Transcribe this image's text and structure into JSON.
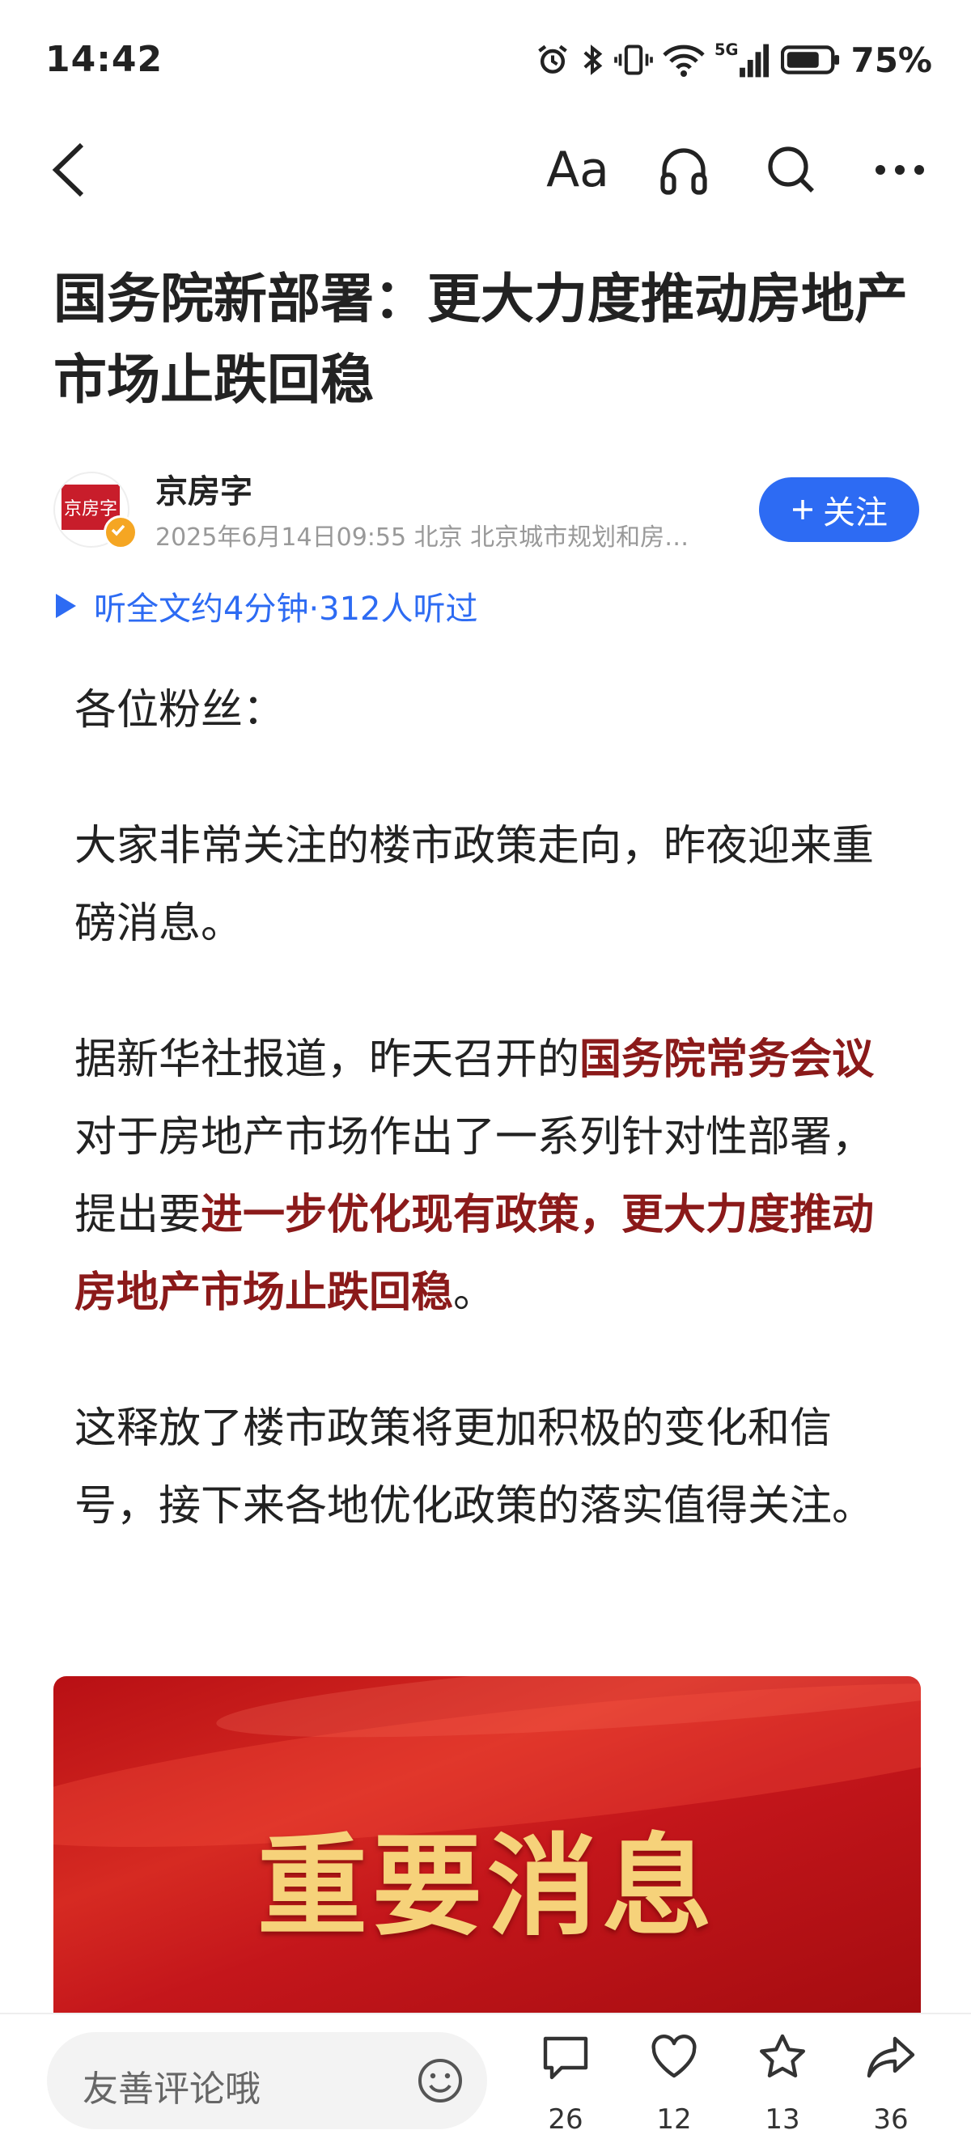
{
  "status_bar": {
    "time": "14:42",
    "network": "5G",
    "battery": "75%"
  },
  "nav": {
    "font_label": "Aa"
  },
  "article": {
    "title": "国务院新部署：更大力度推动房地产市场止跌回稳",
    "author": {
      "name": "京房字",
      "avatar_text": "京房字",
      "meta": "2025年6月14日09:55 北京 北京城市规划和房…",
      "follow_label": "关注"
    },
    "listen_text": "听全文约4分钟·312人听过",
    "paragraphs": {
      "p1": "各位粉丝：",
      "p2": "大家非常关注的楼市政策走向，昨夜迎来重磅消息。",
      "p3_a": "据新华社报道，昨天召开的",
      "p3_b": "国务院常务会议",
      "p3_c": "对于房地产市场作出了一系列针对性部署，提出要",
      "p3_d": "进一步优化现有政策，更大力度推动房地产市场止跌回稳",
      "p3_e": "。",
      "p4": "这释放了楼市政策将更加积极的变化和信号，接下来各地优化政策的落实值得关注。"
    },
    "banner_text": "重要消息"
  },
  "bottom_bar": {
    "comment_placeholder": "友善评论哦",
    "comments": "26",
    "likes": "12",
    "favorites": "13",
    "shares": "36"
  },
  "colors": {
    "accent": "#2d6bf3",
    "highlight": "#8b1a1a",
    "banner": "#c4161b"
  }
}
